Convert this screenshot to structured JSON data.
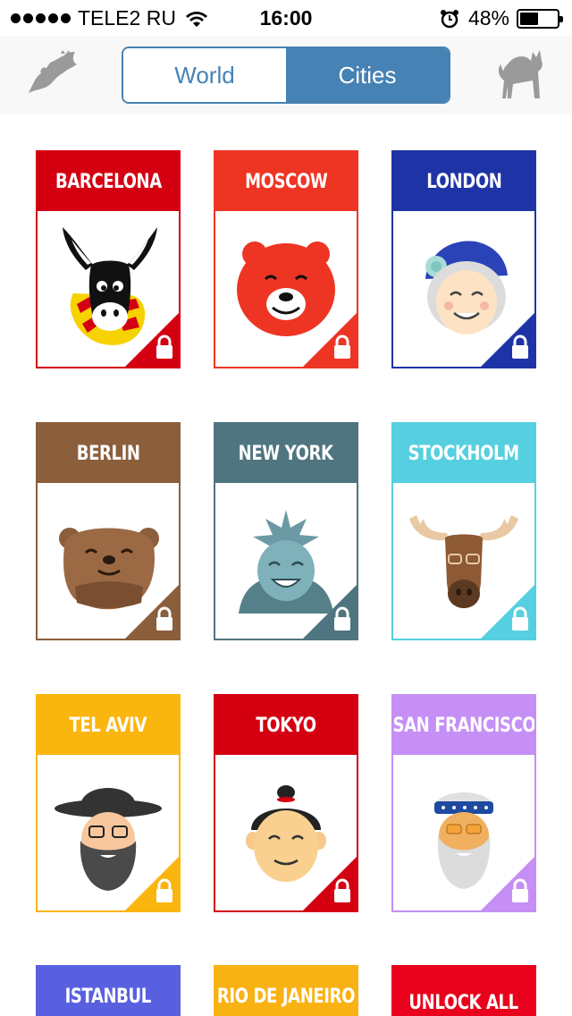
{
  "status_bar": {
    "carrier": "TELE2 RU",
    "time": "16:00",
    "battery_percent": "48%"
  },
  "nav": {
    "tabs": [
      {
        "label": "World",
        "selected": false
      },
      {
        "label": "Cities",
        "selected": true
      }
    ],
    "left_icon": "bat-icon",
    "right_icon": "cat-icon"
  },
  "colors": {
    "accent": "#4682b4",
    "barcelona": "#d40012",
    "moscow": "#ee3524",
    "london": "#1e34a6",
    "berlin": "#8b5e3c",
    "new_york": "#4e7580",
    "stockholm": "#56d0e0",
    "tel_aviv": "#fbb50f",
    "tokyo": "#d40012",
    "san_francisco": "#c58ff5",
    "istanbul": "#5860e0",
    "rio": "#f9b214",
    "unlock": "#e8001c"
  },
  "cities": [
    {
      "name": "BARCELONA",
      "icon": "donkey-icon",
      "locked": true
    },
    {
      "name": "MOSCOW",
      "icon": "bear-icon",
      "locked": true
    },
    {
      "name": "LONDON",
      "icon": "queen-icon",
      "locked": true
    },
    {
      "name": "BERLIN",
      "icon": "berlin-bear-icon",
      "locked": true
    },
    {
      "name": "NEW YORK",
      "icon": "liberty-icon",
      "locked": true
    },
    {
      "name": "STOCKHOLM",
      "icon": "moose-icon",
      "locked": true
    },
    {
      "name": "TEL AVIV",
      "icon": "rabbi-icon",
      "locked": true
    },
    {
      "name": "TOKYO",
      "icon": "sumo-icon",
      "locked": true
    },
    {
      "name": "SAN FRANCISCO",
      "icon": "hippie-icon",
      "locked": true
    },
    {
      "name": "ISTANBUL",
      "icon": "",
      "locked": true
    },
    {
      "name": "RIO DE JANEIRO",
      "icon": "",
      "locked": true
    }
  ],
  "unlock_card": {
    "label": "UNLOCK ALL"
  }
}
